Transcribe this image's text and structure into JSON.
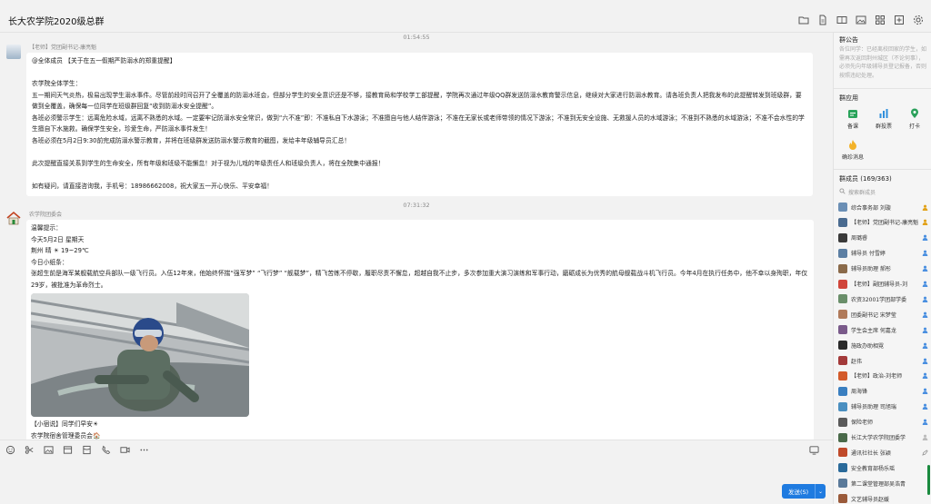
{
  "window": {
    "title": "长大农学院2020级总群"
  },
  "messages": [
    {
      "time": "01:54:55",
      "sender": "【老师】党团副书记-康亮魁",
      "lines": [
        "@全体成员 【关于在五一假期严防溺水的郑重提醒】",
        "",
        "农学院全体学生：",
        "      五一期间天气炎热，极易出现学生溺水事件。尽管前段时间召开了全覆盖的防溺水班会，但部分学生的安全意识还是不够，接教育局和学校学工部提醒，学院再次通过年级QQ群发送防溺水教育警示信息，继续对大家进行防溺水教育。请各班负责人把我发布的此提醒转发到班级群，要做到全覆盖，确保每一位同学在班级群回复“收到防溺水安全提醒”。",
        "      各班必须警示学生：远离危险水域，远离不熟悉的水域。一定要牢记防溺水安全常识，做到“六不准”即：不准私自下水游泳；不准擅自与他人结伴游泳；不准在无家长或老师带领的情况下游泳；不准到无安全设施、无救援人员的水域游泳；不准到不熟悉的水域游泳；不准不会水性的学生擅自下水施救。确保学生安全，珍爱生命，严防溺水事件发生！",
        "      各班必须在5月2日9:30前完成防溺水警示教育，并将在班级群发送防溺水警示教育的截图，发给丰年级辅导员汇总！",
        "",
        "      此次提醒直接关系到学生的生命安全，所有年级和班级不能懈怠！对于视为儿戏的年级责任人和班级负责人，将在全院集中通报！",
        "",
        "      如有疑问，请直接咨询我，手机号：18986662008，祝大家五一开心快乐、平安幸福！"
      ]
    },
    {
      "time": "07:31:32",
      "sender": "农学院团委会",
      "lines": [
        "温馨提示：",
        "今天5月2日 星期天",
        "荆州 晴 ☀ 19~29℃",
        "今日小纸条：",
        "      张超生前是海军某舰载航空兵部队一级飞行员。入伍12年来，他始终怀揣“强军梦” “飞行梦” “舰载梦”，精飞苦练不停歇，履职尽责不懈怠，超越自我不止步，多次参加重大演习演练和军事行动，磨砺成长为优秀的航母舰载战斗机飞行员。今年4月在执行任务中，他不幸以身殉职，年仅29岁，被批准为革命烈士。"
      ],
      "after_image": [
        "【小宿说】同学们早安☀",
        "农学院宿舍管理委员会🏠"
      ]
    }
  ],
  "composer": {
    "send_label": "发送(S)",
    "send_dropdown": "⌄"
  },
  "sidebar": {
    "notice_title": "群公告",
    "notice_text": "各位同学：已经离校回家的学生，如需再次返回荆州城区（不论何事），必须先向年级辅导员登记报备，否则按照违纪处理。",
    "apps_title": "群应用",
    "apps": [
      {
        "label": "备课",
        "icon": "calendar-icon",
        "color": "#29a35a"
      },
      {
        "label": "群投票",
        "icon": "vote-icon",
        "color": "#2f8fdc"
      },
      {
        "label": "打卡",
        "icon": "checkin-icon",
        "color": "#2aa05a"
      },
      {
        "label": "确珍消息",
        "icon": "flame-icon",
        "color": "#f3b229"
      }
    ],
    "members_title": "群成员 (169/363)",
    "search_placeholder": "搜索群成员",
    "members": [
      {
        "name": "综合事务部 刘璇",
        "mark": "gold",
        "color": "#6b8fb5"
      },
      {
        "name": "【老师】党团副书记-康亮魁",
        "mark": "gold",
        "color": "#4a6b90"
      },
      {
        "name": "周璐睿",
        "mark": "blue",
        "color": "#3a3a3a"
      },
      {
        "name": "辅导员 付雪婷",
        "mark": "blue",
        "color": "#5c7fa3"
      },
      {
        "name": "辅导员助理 郝彤",
        "mark": "blue",
        "color": "#8a6a4a"
      },
      {
        "name": "【老师】副团辅导员-刘",
        "mark": "blue",
        "color": "#d0453a"
      },
      {
        "name": "农资32001学团部学委",
        "mark": "blue",
        "color": "#6a8f6a"
      },
      {
        "name": "团委副书记 宋梦莹",
        "mark": "blue",
        "color": "#b07a5a"
      },
      {
        "name": "学生会主席 何嘉龙",
        "mark": "blue",
        "color": "#7a5a8a"
      },
      {
        "name": "施政办助相霓",
        "mark": "blue",
        "color": "#2a2a2a"
      },
      {
        "name": "赵伟",
        "mark": "blue",
        "color": "#a33a3a"
      },
      {
        "name": "【老师】政治-刘老师",
        "mark": "blue",
        "color": "#d35a2a"
      },
      {
        "name": "周海锋",
        "mark": "blue",
        "color": "#3a7fc0"
      },
      {
        "name": "辅导员助理 司旭瑞",
        "mark": "blue",
        "color": "#4a8fc0"
      },
      {
        "name": "保险老师",
        "mark": "blue",
        "color": "#5a5a5a"
      },
      {
        "name": "长江大学农学院团委学",
        "mark": "gray",
        "color": "#4a6a4a"
      },
      {
        "name": "通讯社社长 张颖",
        "mark": "edit",
        "color": "#c04a2a"
      },
      {
        "name": "安全教育部杨乐瑶",
        "mark": "none",
        "color": "#2a6a9a"
      },
      {
        "name": "第二课堂管理部吴浩青",
        "mark": "none",
        "color": "#5a7a9a"
      },
      {
        "name": "文艺辅导员赵媛",
        "mark": "none",
        "color": "#9a5a3a"
      }
    ]
  }
}
